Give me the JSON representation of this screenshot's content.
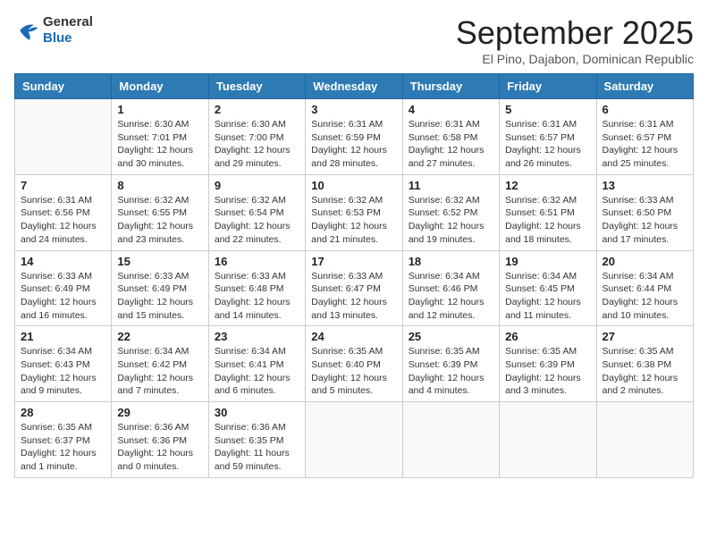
{
  "header": {
    "logo_general": "General",
    "logo_blue": "Blue",
    "month_title": "September 2025",
    "subtitle": "El Pino, Dajabon, Dominican Republic"
  },
  "weekdays": [
    "Sunday",
    "Monday",
    "Tuesday",
    "Wednesday",
    "Thursday",
    "Friday",
    "Saturday"
  ],
  "weeks": [
    [
      {
        "day": "",
        "info": ""
      },
      {
        "day": "1",
        "info": "Sunrise: 6:30 AM\nSunset: 7:01 PM\nDaylight: 12 hours\nand 30 minutes."
      },
      {
        "day": "2",
        "info": "Sunrise: 6:30 AM\nSunset: 7:00 PM\nDaylight: 12 hours\nand 29 minutes."
      },
      {
        "day": "3",
        "info": "Sunrise: 6:31 AM\nSunset: 6:59 PM\nDaylight: 12 hours\nand 28 minutes."
      },
      {
        "day": "4",
        "info": "Sunrise: 6:31 AM\nSunset: 6:58 PM\nDaylight: 12 hours\nand 27 minutes."
      },
      {
        "day": "5",
        "info": "Sunrise: 6:31 AM\nSunset: 6:57 PM\nDaylight: 12 hours\nand 26 minutes."
      },
      {
        "day": "6",
        "info": "Sunrise: 6:31 AM\nSunset: 6:57 PM\nDaylight: 12 hours\nand 25 minutes."
      }
    ],
    [
      {
        "day": "7",
        "info": "Sunrise: 6:31 AM\nSunset: 6:56 PM\nDaylight: 12 hours\nand 24 minutes."
      },
      {
        "day": "8",
        "info": "Sunrise: 6:32 AM\nSunset: 6:55 PM\nDaylight: 12 hours\nand 23 minutes."
      },
      {
        "day": "9",
        "info": "Sunrise: 6:32 AM\nSunset: 6:54 PM\nDaylight: 12 hours\nand 22 minutes."
      },
      {
        "day": "10",
        "info": "Sunrise: 6:32 AM\nSunset: 6:53 PM\nDaylight: 12 hours\nand 21 minutes."
      },
      {
        "day": "11",
        "info": "Sunrise: 6:32 AM\nSunset: 6:52 PM\nDaylight: 12 hours\nand 19 minutes."
      },
      {
        "day": "12",
        "info": "Sunrise: 6:32 AM\nSunset: 6:51 PM\nDaylight: 12 hours\nand 18 minutes."
      },
      {
        "day": "13",
        "info": "Sunrise: 6:33 AM\nSunset: 6:50 PM\nDaylight: 12 hours\nand 17 minutes."
      }
    ],
    [
      {
        "day": "14",
        "info": "Sunrise: 6:33 AM\nSunset: 6:49 PM\nDaylight: 12 hours\nand 16 minutes."
      },
      {
        "day": "15",
        "info": "Sunrise: 6:33 AM\nSunset: 6:49 PM\nDaylight: 12 hours\nand 15 minutes."
      },
      {
        "day": "16",
        "info": "Sunrise: 6:33 AM\nSunset: 6:48 PM\nDaylight: 12 hours\nand 14 minutes."
      },
      {
        "day": "17",
        "info": "Sunrise: 6:33 AM\nSunset: 6:47 PM\nDaylight: 12 hours\nand 13 minutes."
      },
      {
        "day": "18",
        "info": "Sunrise: 6:34 AM\nSunset: 6:46 PM\nDaylight: 12 hours\nand 12 minutes."
      },
      {
        "day": "19",
        "info": "Sunrise: 6:34 AM\nSunset: 6:45 PM\nDaylight: 12 hours\nand 11 minutes."
      },
      {
        "day": "20",
        "info": "Sunrise: 6:34 AM\nSunset: 6:44 PM\nDaylight: 12 hours\nand 10 minutes."
      }
    ],
    [
      {
        "day": "21",
        "info": "Sunrise: 6:34 AM\nSunset: 6:43 PM\nDaylight: 12 hours\nand 9 minutes."
      },
      {
        "day": "22",
        "info": "Sunrise: 6:34 AM\nSunset: 6:42 PM\nDaylight: 12 hours\nand 7 minutes."
      },
      {
        "day": "23",
        "info": "Sunrise: 6:34 AM\nSunset: 6:41 PM\nDaylight: 12 hours\nand 6 minutes."
      },
      {
        "day": "24",
        "info": "Sunrise: 6:35 AM\nSunset: 6:40 PM\nDaylight: 12 hours\nand 5 minutes."
      },
      {
        "day": "25",
        "info": "Sunrise: 6:35 AM\nSunset: 6:39 PM\nDaylight: 12 hours\nand 4 minutes."
      },
      {
        "day": "26",
        "info": "Sunrise: 6:35 AM\nSunset: 6:39 PM\nDaylight: 12 hours\nand 3 minutes."
      },
      {
        "day": "27",
        "info": "Sunrise: 6:35 AM\nSunset: 6:38 PM\nDaylight: 12 hours\nand 2 minutes."
      }
    ],
    [
      {
        "day": "28",
        "info": "Sunrise: 6:35 AM\nSunset: 6:37 PM\nDaylight: 12 hours\nand 1 minute."
      },
      {
        "day": "29",
        "info": "Sunrise: 6:36 AM\nSunset: 6:36 PM\nDaylight: 12 hours\nand 0 minutes."
      },
      {
        "day": "30",
        "info": "Sunrise: 6:36 AM\nSunset: 6:35 PM\nDaylight: 11 hours\nand 59 minutes."
      },
      {
        "day": "",
        "info": ""
      },
      {
        "day": "",
        "info": ""
      },
      {
        "day": "",
        "info": ""
      },
      {
        "day": "",
        "info": ""
      }
    ]
  ]
}
